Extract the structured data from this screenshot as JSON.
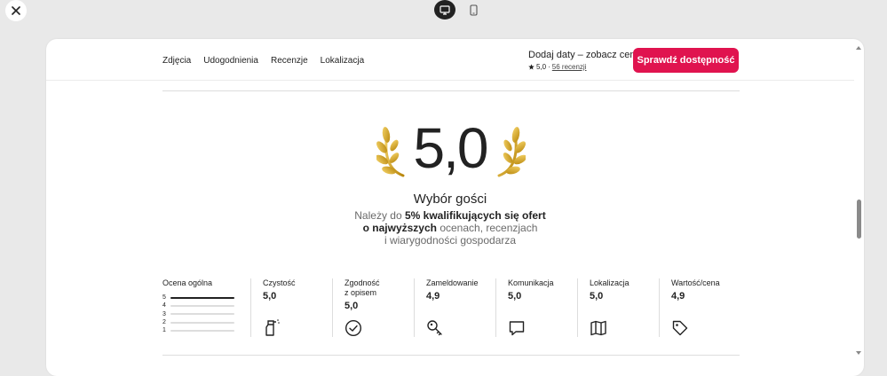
{
  "nav": {
    "links": [
      "Zdjęcia",
      "Udogodnienia",
      "Recenzje",
      "Lokalizacja"
    ]
  },
  "booking": {
    "title": "Dodaj daty – zobacz ceny",
    "rating": "5,0",
    "dot": "·",
    "reviews_link": "56 recenzji",
    "cta_label": "Sprawdź dostępność"
  },
  "hero": {
    "score": "5,0",
    "title": "Wybór gości",
    "desc_1a": "Należy do ",
    "desc_1b": "5% kwalifikujących się ofert",
    "desc_2a": "o najwyższych",
    "desc_2b": " ocenach, recenzjach",
    "desc_3": "i wiarygodności gospodarza"
  },
  "overall": {
    "label": "Ocena ogólna",
    "rows": [
      {
        "star": "5",
        "fraction": 1.0
      },
      {
        "star": "4",
        "fraction": 0.0
      },
      {
        "star": "3",
        "fraction": 0.0
      },
      {
        "star": "2",
        "fraction": 0.0
      },
      {
        "star": "1",
        "fraction": 0.0
      }
    ]
  },
  "categories": [
    {
      "label": "Czystość",
      "value": "5,0",
      "icon": "spray-bottle-icon"
    },
    {
      "label": "Zgodność z opisem",
      "value": "5,0",
      "icon": "check-circle-icon"
    },
    {
      "label": "Zameldowanie",
      "value": "4,9",
      "icon": "key-icon"
    },
    {
      "label": "Komunikacja",
      "value": "5,0",
      "icon": "chat-bubble-icon"
    },
    {
      "label": "Lokalizacja",
      "value": "5,0",
      "icon": "map-icon"
    },
    {
      "label": "Wartość/cena",
      "value": "4,9",
      "icon": "price-tag-icon"
    }
  ],
  "top": {
    "close_icon": "close-icon",
    "desktop_icon": "desktop-icon",
    "mobile_icon": "mobile-icon"
  },
  "colors": {
    "accent": "#e0134f",
    "gold": "#d4a017"
  }
}
